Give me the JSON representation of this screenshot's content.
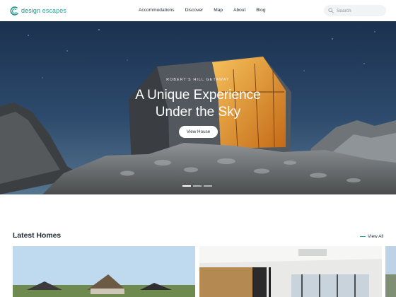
{
  "header": {
    "logo": {
      "part1": "design",
      "part2": "escapes"
    },
    "nav": [
      "Accommodations",
      "Discover",
      "Map",
      "About",
      "Blog"
    ],
    "search": {
      "placeholder": "Search",
      "value": ""
    }
  },
  "hero": {
    "kicker": "ROBERT'S HILL GETAWAY",
    "title_line1": "A Unique Experience",
    "title_line2": "Under the Sky",
    "button_label": "View House",
    "slides_total": 3,
    "active_slide": 1
  },
  "latest": {
    "title": "Latest Homes",
    "view_all": "View All"
  },
  "colors": {
    "brand": "#26a69a",
    "sky_top": "#1b3150",
    "sky_bottom": "#4f6f8d",
    "cabin_light": "#e89a2e"
  },
  "icons": [
    "logo-mark-icon",
    "search-icon"
  ]
}
